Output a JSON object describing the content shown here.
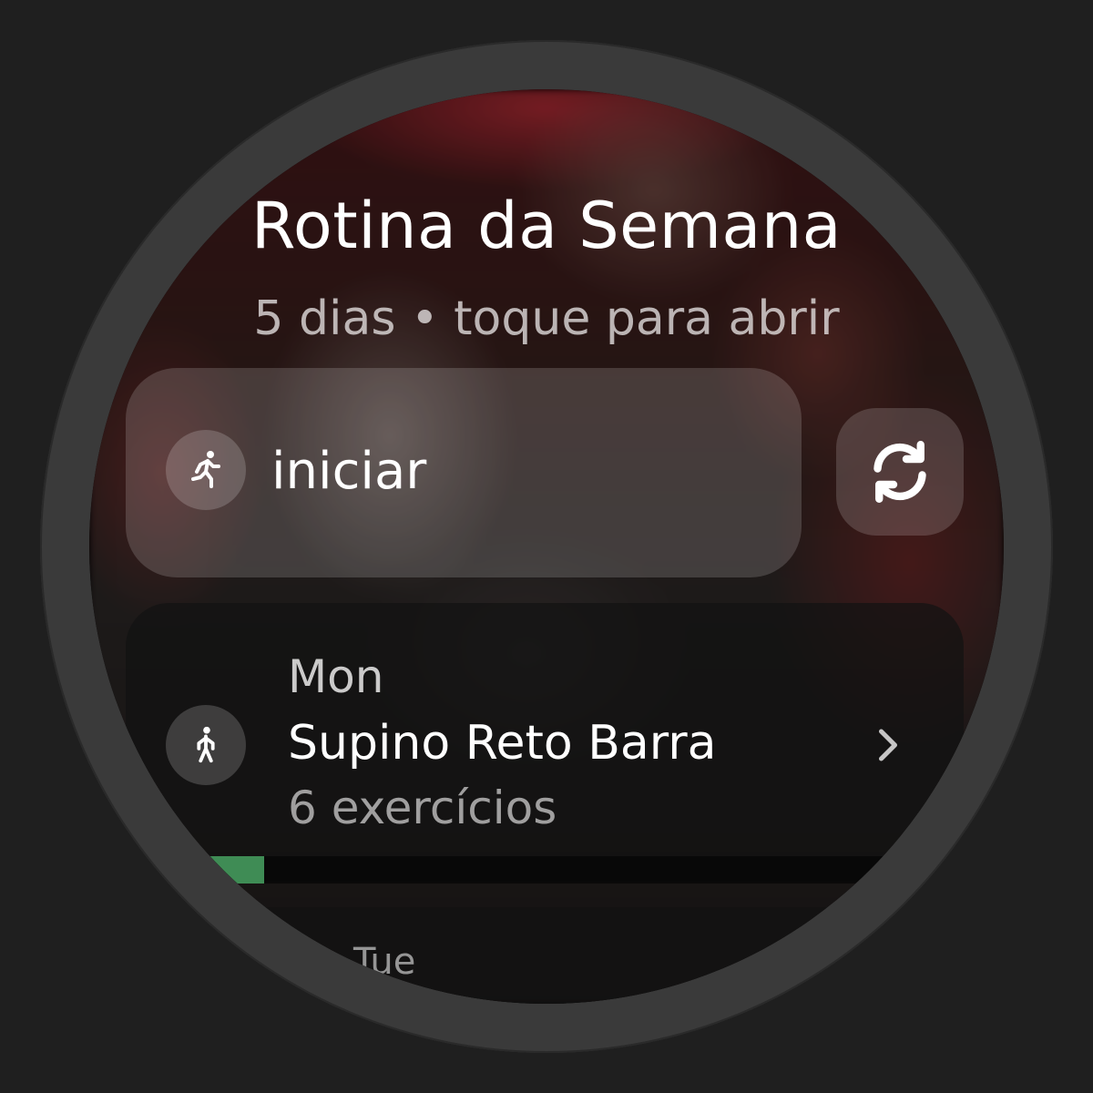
{
  "header": {
    "title": "Rotina da Semana",
    "subtitle": "5 dias • toque para abrir"
  },
  "actions": {
    "start_label": "iniciar",
    "start_icon": "person-running-icon",
    "refresh_icon": "refresh-icon"
  },
  "days": [
    {
      "day": "Mon",
      "title": "Supino Reto Barra",
      "count": "6 exercícios",
      "icon": "person-walking-icon",
      "progress": 0.07,
      "progress_color": "#3f8c55"
    },
    {
      "day": "Tue"
    }
  ]
}
